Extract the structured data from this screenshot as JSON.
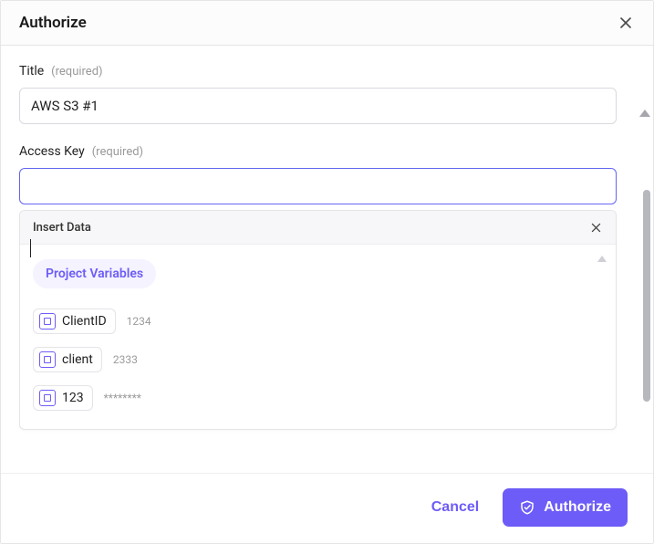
{
  "header": {
    "title": "Authorize"
  },
  "fields": {
    "title": {
      "label": "Title",
      "required_hint": "(required)",
      "value": "AWS S3 #1"
    },
    "access_key": {
      "label": "Access Key",
      "required_hint": "(required)",
      "value": ""
    }
  },
  "suggest": {
    "header": "Insert Data",
    "category_chip": "Project Variables",
    "items": [
      {
        "name": "ClientID",
        "preview": "1234"
      },
      {
        "name": "client",
        "preview": "2333"
      },
      {
        "name": "123",
        "preview": "********"
      }
    ]
  },
  "footer": {
    "cancel": "Cancel",
    "authorize": "Authorize"
  },
  "icons": {
    "close": "close-icon",
    "variable": "variable-icon",
    "shield": "shield-check-icon"
  },
  "colors": {
    "accent": "#6d5cf7",
    "focus_ring": "#6366f1"
  }
}
